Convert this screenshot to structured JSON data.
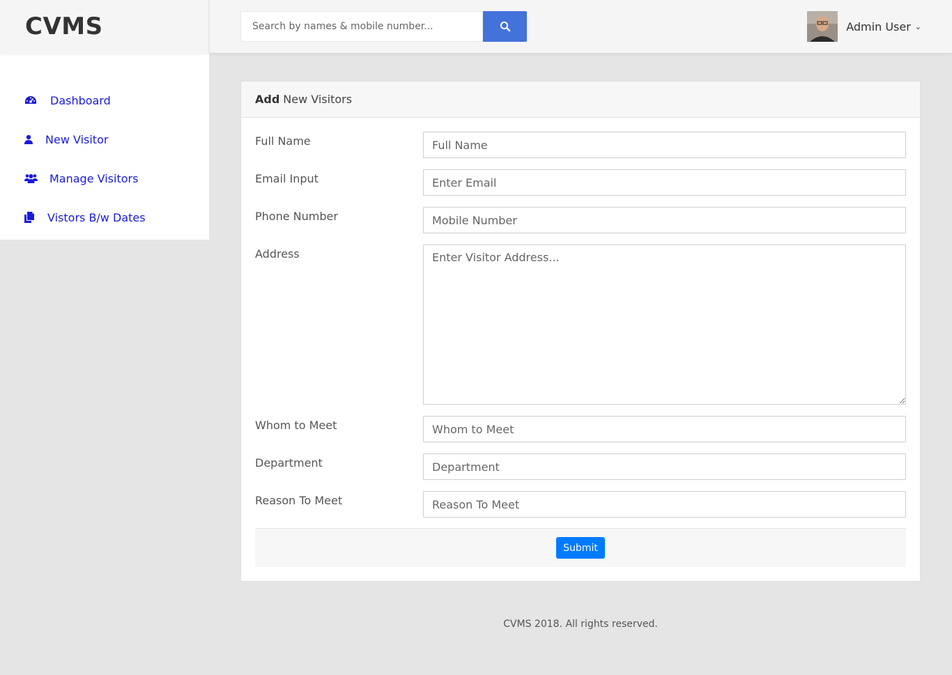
{
  "app": {
    "logo": "CVMS"
  },
  "search": {
    "placeholder": "Search by names & mobile number..."
  },
  "user": {
    "name": "Admin User"
  },
  "sidebar": {
    "items": [
      {
        "label": "Dashboard",
        "icon": "dashboard-icon"
      },
      {
        "label": "New Visitor",
        "icon": "user-icon"
      },
      {
        "label": "Manage Visitors",
        "icon": "users-icon"
      },
      {
        "label": "Vistors B/w Dates",
        "icon": "files-icon"
      }
    ]
  },
  "card": {
    "title_bold": "Add",
    "title_rest": "New Visitors",
    "fields": [
      {
        "label": "Full Name",
        "placeholder": "Full Name"
      },
      {
        "label": "Email Input",
        "placeholder": "Enter Email"
      },
      {
        "label": "Phone Number",
        "placeholder": "Mobile Number"
      },
      {
        "label": "Address",
        "placeholder": "Enter Visitor Address..."
      },
      {
        "label": "Whom to Meet",
        "placeholder": "Whom to Meet"
      },
      {
        "label": "Department",
        "placeholder": "Department"
      },
      {
        "label": "Reason To Meet",
        "placeholder": "Reason To Meet"
      }
    ],
    "submit_label": "Submit"
  },
  "footer": {
    "text": "CVMS 2018. All rights reserved."
  },
  "colors": {
    "accent": "#4472db",
    "submit": "#007bff",
    "nav_link": "#1a1adb"
  }
}
